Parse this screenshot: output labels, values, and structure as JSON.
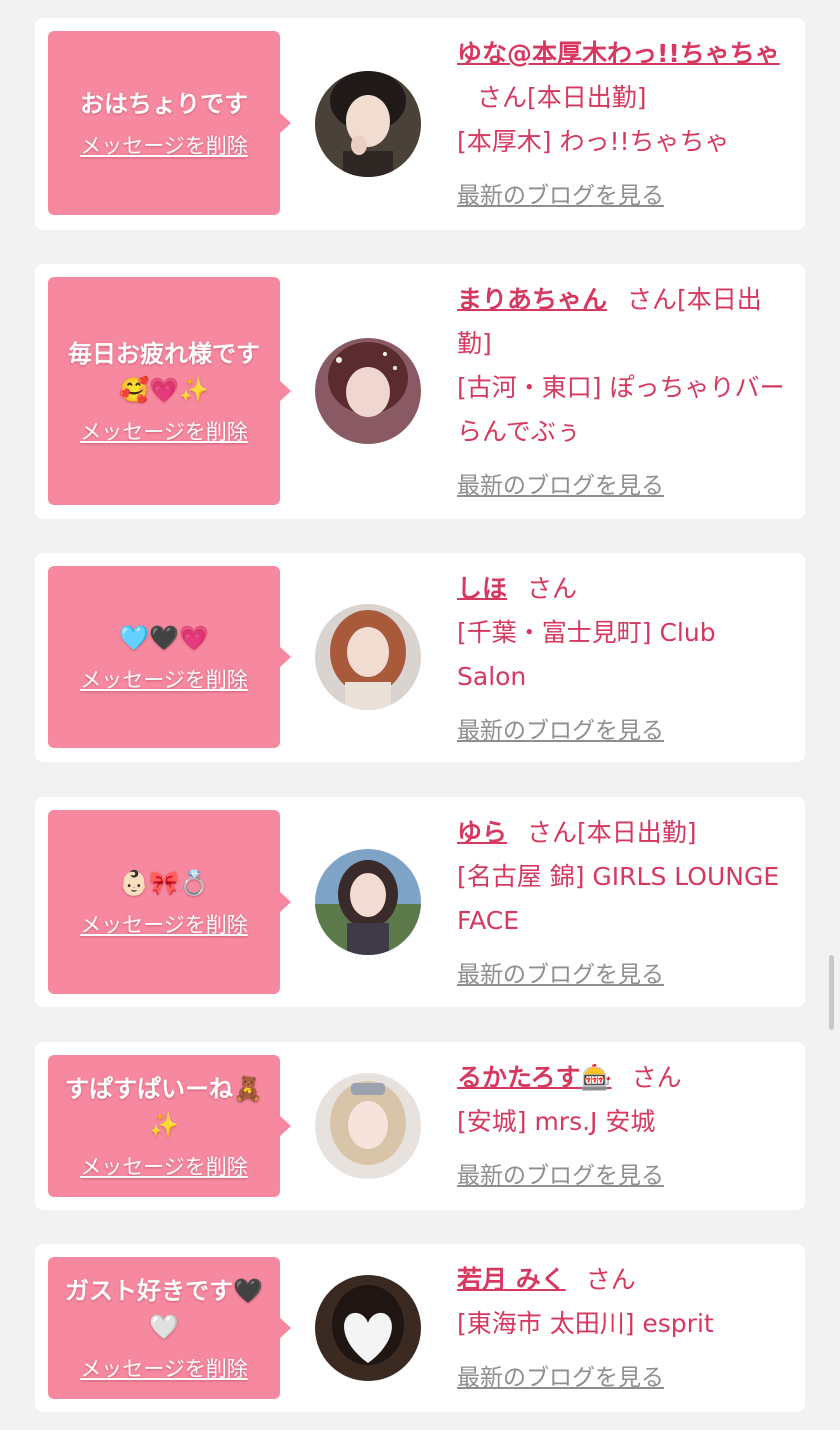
{
  "colors": {
    "background": "#f2f2f2",
    "bubble": "#f6899f",
    "accent": "#d6385f",
    "link_gray": "#8e8e8e"
  },
  "cards": [
    {
      "message": "おはちょりです",
      "delete_label": "メッセージを削除",
      "name": "ゆな@本厚木わっ!!ちゃちゃ",
      "san": "さん",
      "status": "[本日出勤]",
      "shop": "[本厚木] わっ!!ちゃちゃ",
      "blog_label": "最新のブログを見る"
    },
    {
      "message": "毎日お疲れ様です🥰💗✨",
      "delete_label": "メッセージを削除",
      "name": "まりあちゃん",
      "san": "さん",
      "status": "[本日出勤]",
      "shop": "[古河・東口] ぽっちゃりバー らんでぶぅ",
      "blog_label": "最新のブログを見る"
    },
    {
      "message": "🩵🖤💗",
      "delete_label": "メッセージを削除",
      "name": "しほ",
      "san": "さん",
      "status": "",
      "shop": "[千葉・富士見町] Club Salon",
      "blog_label": "最新のブログを見る"
    },
    {
      "message": "👶🏻🎀💍",
      "delete_label": "メッセージを削除",
      "name": "ゆら",
      "san": "さん",
      "status": "[本日出勤]",
      "shop": "[名古屋 錦] GIRLS LOUNGE FACE",
      "blog_label": "最新のブログを見る"
    },
    {
      "message": "すぱすぱいーね🧸✨",
      "delete_label": "メッセージを削除",
      "name": "るかたろす🎰",
      "san": "さん",
      "status": "",
      "shop": "[安城] mrs.J 安城",
      "blog_label": "最新のブログを見る"
    },
    {
      "message": "ガスト好きです🖤🤍",
      "delete_label": "メッセージを削除",
      "name": "若月 みく",
      "san": "さん",
      "status": "",
      "shop": "[東海市 太田川] esprit",
      "blog_label": "最新のブログを見る"
    }
  ]
}
